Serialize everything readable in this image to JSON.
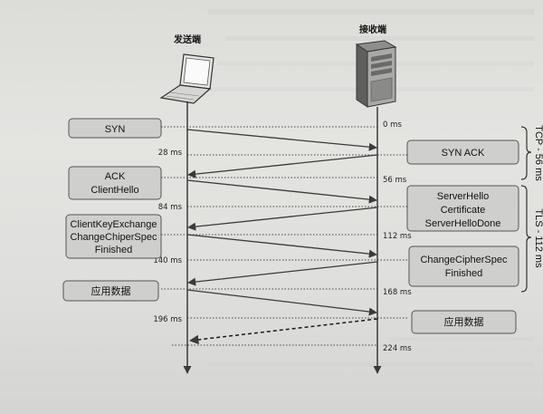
{
  "headers": {
    "sender": "发送端",
    "receiver": "接收端"
  },
  "icons": {
    "sender_device": "laptop-icon",
    "receiver_device": "server-tower-icon"
  },
  "messages": {
    "syn": [
      "SYN"
    ],
    "syn_ack": [
      "SYN ACK"
    ],
    "ack_client_hello": [
      "ACK",
      "ClientHello"
    ],
    "server_hello": [
      "ServerHello",
      "Certificate",
      "ServerHelloDone"
    ],
    "client_key_exchange": [
      "ClientKeyExchange",
      "ChangeChiperSpec",
      "Finished"
    ],
    "change_cipher_spec": [
      "ChangeCipherSpec",
      "Finished"
    ],
    "app_data_sender": [
      "应用数据"
    ],
    "app_data_receiver": [
      "应用数据"
    ]
  },
  "times": {
    "t0": "0 ms",
    "t28": "28 ms",
    "t56": "56 ms",
    "t84": "84 ms",
    "t112": "112 ms",
    "t140": "140 ms",
    "t168": "168 ms",
    "t196": "196 ms",
    "t224": "224 ms"
  },
  "brackets": {
    "tcp": "TCP - 56 ms",
    "tls": "TLS - 112 ms"
  },
  "colors": {
    "box_fill": "#cfd0cd",
    "box_stroke": "#555555",
    "arrow": "#3a3a3a",
    "dotted": "#444444",
    "lifeline": "#222222"
  }
}
